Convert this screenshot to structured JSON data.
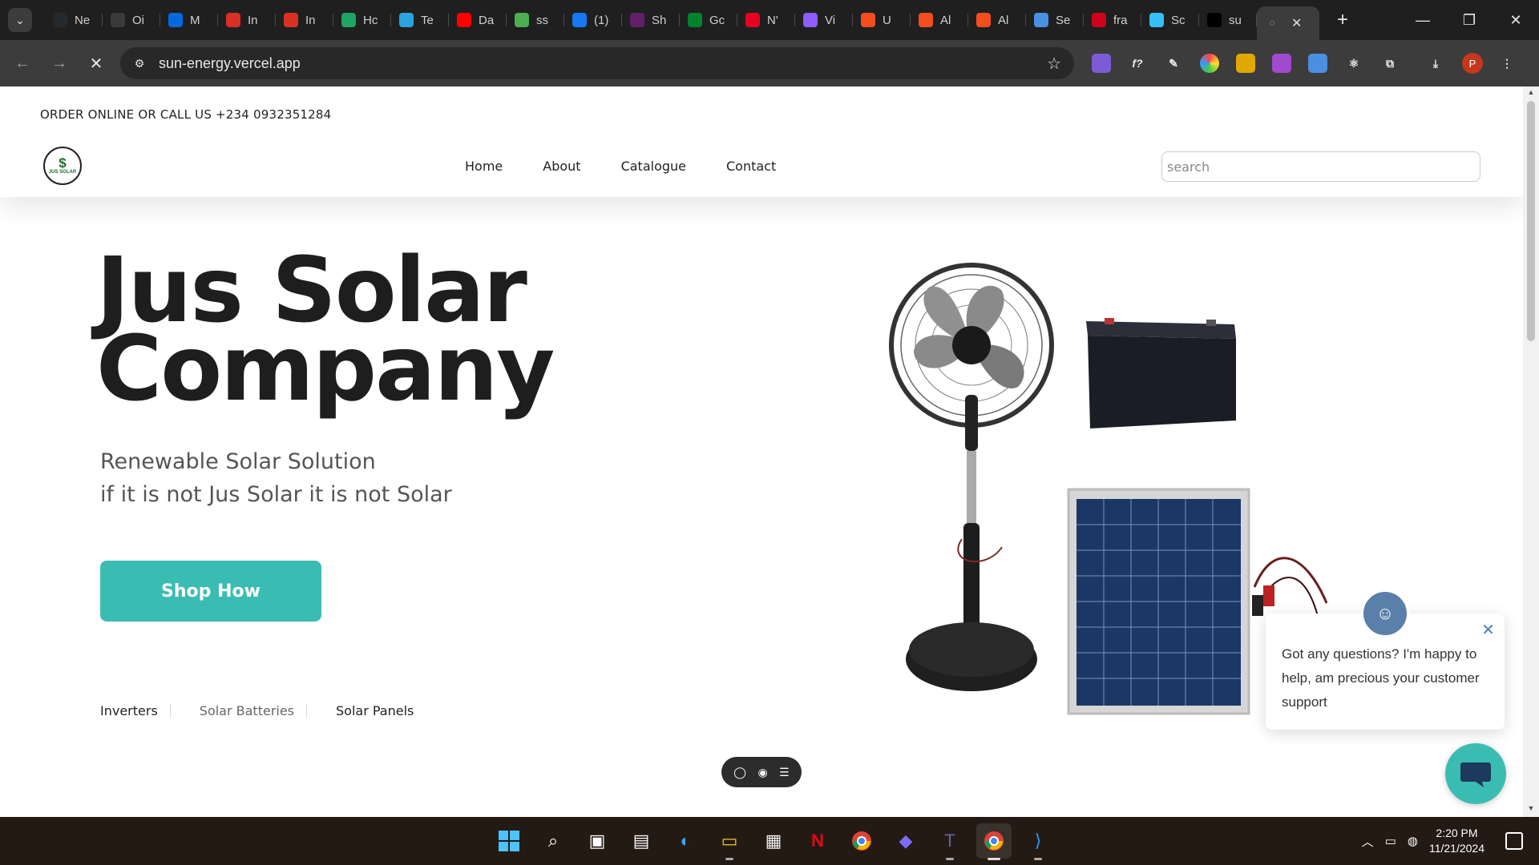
{
  "browser": {
    "tabs": [
      {
        "label": "Ne",
        "icon": "github-icon",
        "color": "#24292e"
      },
      {
        "label": "Oi",
        "icon": "openai-icon",
        "color": "#3a3a3a"
      },
      {
        "label": "M",
        "icon": "meta-icon",
        "color": "#0668e1"
      },
      {
        "label": "In",
        "icon": "gmail-icon",
        "color": "#d93025"
      },
      {
        "label": "In",
        "icon": "gmail-icon",
        "color": "#d93025"
      },
      {
        "label": "Hc",
        "icon": "google-drive-icon",
        "color": "#1fa463"
      },
      {
        "label": "Te",
        "icon": "telegram-icon",
        "color": "#2aa3de"
      },
      {
        "label": "Da",
        "icon": "youtube-icon",
        "color": "#ff0000"
      },
      {
        "label": "ss",
        "icon": "download-icon",
        "color": "#4caf50"
      },
      {
        "label": "(1)",
        "icon": "facebook-icon",
        "color": "#1877f2"
      },
      {
        "label": "Sh",
        "icon": "slack-icon",
        "color": "#611f69"
      },
      {
        "label": "Gc",
        "icon": "google-meet-icon",
        "color": "#00832d"
      },
      {
        "label": "N'",
        "icon": "pinterest-icon",
        "color": "#e60023"
      },
      {
        "label": "Vi",
        "icon": "vite-icon",
        "color": "#8e5cff"
      },
      {
        "label": "U",
        "icon": "figma-icon",
        "color": "#f24e1e"
      },
      {
        "label": "Al",
        "icon": "figma-icon",
        "color": "#f24e1e"
      },
      {
        "label": "Al",
        "icon": "figma-icon",
        "color": "#f24e1e"
      },
      {
        "label": "Se",
        "icon": "multicolor-icon",
        "color": "#4a90e2"
      },
      {
        "label": "fra",
        "icon": "framer-icon",
        "color": "#d0021b"
      },
      {
        "label": "Sc",
        "icon": "tailwind-icon",
        "color": "#38bdf8"
      },
      {
        "label": "su",
        "icon": "vercel-icon",
        "color": "#000000"
      }
    ],
    "active_tab": {
      "label": "",
      "icon": "loading-icon"
    },
    "url": "sun-energy.vercel.app",
    "profile_initial": "P"
  },
  "site": {
    "topline": "ORDER ONLINE OR CALL US +234 0932351284",
    "logo_symbol": "$",
    "logo_text": "JUS SOLAR",
    "nav": [
      "Home",
      "About",
      "Catalogue",
      "Contact"
    ],
    "search_placeholder": "search",
    "hero": {
      "title_line1": "Jus Solar",
      "title_line2": "Company",
      "subtitle_line1": "Renewable Solar Solution",
      "subtitle_line2": "if it is not Jus Solar it is not Solar",
      "cta": "Shop How"
    },
    "categories": [
      "Inverters",
      "Solar Batteries",
      "Solar Panels"
    ],
    "accent_color": "#3bbcb3"
  },
  "chat": {
    "message": "Got any questions? I'm happy to help, am precious your customer support"
  },
  "taskbar": {
    "time": "2:20 PM",
    "date": "11/21/2024"
  }
}
